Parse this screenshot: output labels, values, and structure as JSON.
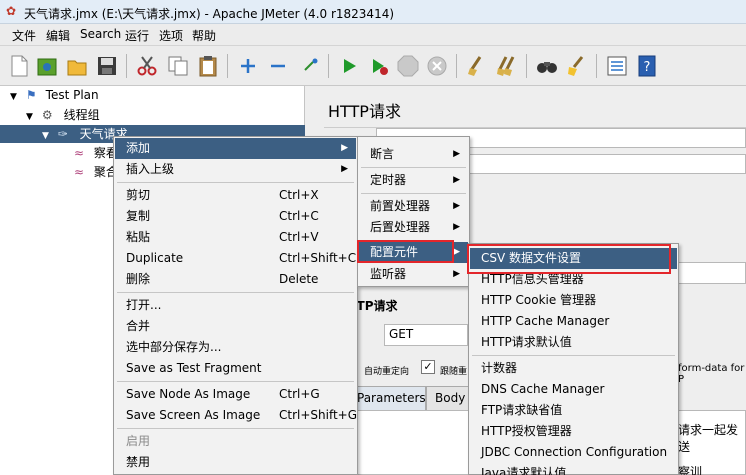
{
  "window": {
    "title": "天气请求.jmx (E:\\天气请求.jmx) - Apache JMeter (4.0 r1823414)"
  },
  "menubar": [
    "文件",
    "编辑",
    "Search",
    "运行",
    "选项",
    "帮助"
  ],
  "toolbar": {
    "icons": [
      "new-icon",
      "templates-icon",
      "open-icon",
      "save-icon",
      "cut-icon",
      "copy-icon",
      "paste-icon",
      "expand-icon",
      "collapse-icon",
      "toggle-icon",
      "start-icon",
      "start-no-pause-icon",
      "stop-icon",
      "shutdown-icon",
      "clear-icon",
      "clear-all-icon",
      "search-icon",
      "reset-search-icon",
      "function-helper-icon",
      "help-icon"
    ]
  },
  "tree": {
    "test_plan": "Test Plan",
    "thread_group": "线程组",
    "sampler": "天气请求",
    "child1": "察看",
    "child2": "聚合"
  },
  "panel": {
    "title": "HTTP请求",
    "section": "HTTP请求",
    "method_label": "法:",
    "method_value": "GET",
    "redirect_label": "自动重定向",
    "follow_label": "跟随重",
    "tab_parameters": "Parameters",
    "tab_body": "Body D",
    "multipart_text": "form-data for P",
    "send_text": "请求一起发送",
    "bottom_text": "察训"
  },
  "context_menu": {
    "items": [
      {
        "label": "添加",
        "submenu": true
      },
      {
        "label": "插入上级",
        "submenu": true
      },
      {
        "label": "剪切",
        "shortcut": "Ctrl+X"
      },
      {
        "label": "复制",
        "shortcut": "Ctrl+C"
      },
      {
        "label": "粘贴",
        "shortcut": "Ctrl+V"
      },
      {
        "label": "Duplicate",
        "shortcut": "Ctrl+Shift+C"
      },
      {
        "label": "删除",
        "shortcut": "Delete"
      },
      {
        "label": "打开..."
      },
      {
        "label": "合并"
      },
      {
        "label": "选中部分保存为..."
      },
      {
        "label": "Save as Test Fragment"
      },
      {
        "label": "Save Node As Image",
        "shortcut": "Ctrl+G"
      },
      {
        "label": "Save Screen As Image",
        "shortcut": "Ctrl+Shift+G"
      },
      {
        "label": "启用"
      },
      {
        "label": "禁用"
      }
    ]
  },
  "add_submenu": {
    "items": [
      "断言",
      "定时器",
      "前置处理器",
      "后置处理器",
      "配置元件",
      "监听器"
    ]
  },
  "config_submenu": {
    "items": [
      "CSV 数据文件设置",
      "HTTP信息头管理器",
      "HTTP Cookie 管理器",
      "HTTP Cache Manager",
      "HTTP请求默认值",
      "计数器",
      "DNS Cache Manager",
      "FTP请求缺省值",
      "HTTP授权管理器",
      "JDBC Connection Configuration",
      "Java请求默认值"
    ]
  },
  "colors": {
    "highlight": "#3c5f83",
    "annotation_red": "#e3262b"
  }
}
